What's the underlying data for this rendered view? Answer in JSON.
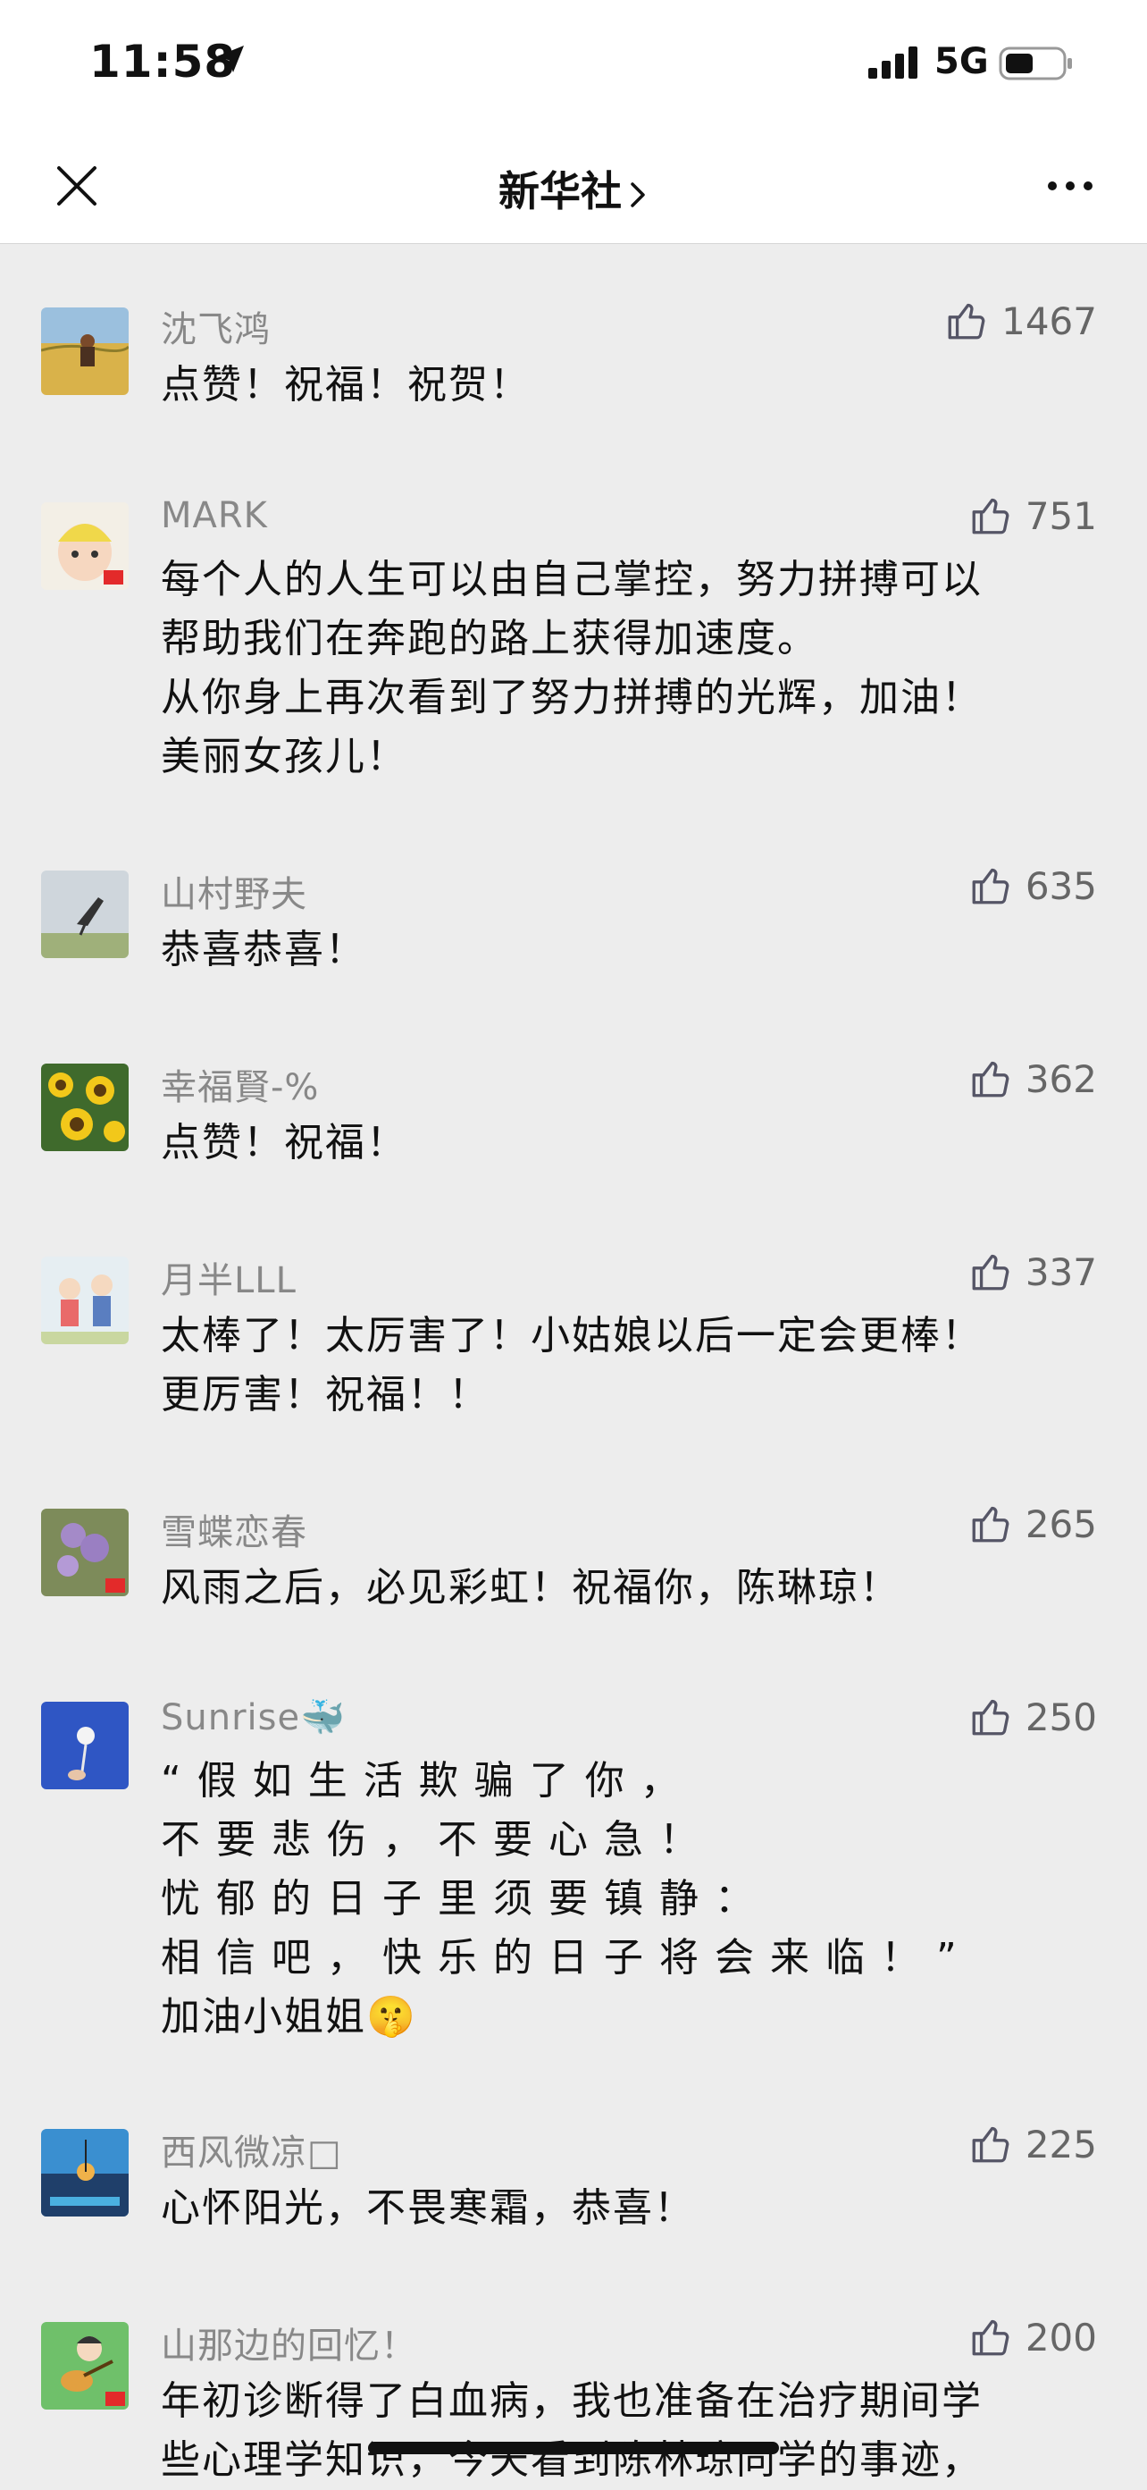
{
  "status_bar": {
    "time": "11:58",
    "network": "5G"
  },
  "nav": {
    "title": "新华社"
  },
  "colors": {
    "background": "#ededed",
    "username": "#888888",
    "text": "#111111"
  },
  "comments": [
    {
      "user": "沈飞鸿",
      "likes": "1467",
      "lines": [
        "点赞！祝福！祝贺！"
      ],
      "avatar": "wheat-field-avatar"
    },
    {
      "user": "MARK",
      "likes": "751",
      "lines": [
        "每个人的人生可以由自己掌控，努力拼搏可以",
        "帮助我们在奔跑的路上获得加速度。",
        "从你身上再次看到了努力拼搏的光辉，加油！",
        "美丽女孩儿！"
      ],
      "avatar": "baby-avatar"
    },
    {
      "user": "山村野夫",
      "likes": "635",
      "lines": [
        "恭喜恭喜！"
      ],
      "avatar": "bird-avatar"
    },
    {
      "user": "幸福賢-%",
      "likes": "362",
      "lines": [
        "点赞！祝福！"
      ],
      "avatar": "sunflower-avatar"
    },
    {
      "user": "月半LLL",
      "likes": "337",
      "lines": [
        "太棒了！太厉害了！小姑娘以后一定会更棒！",
        "更厉害！祝福！！"
      ],
      "avatar": "cartoon-avatar"
    },
    {
      "user": "雪蝶恋春",
      "likes": "265",
      "lines": [
        "风雨之后，必见彩虹！祝福你，陈琳琼！"
      ],
      "avatar": "flower-avatar"
    },
    {
      "user": "Sunrise",
      "user_emoji": "🐳",
      "likes": "250",
      "lines": [
        "“假如生活欺骗了你，",
        "不要悲伤，不要心急！",
        "忧郁的日子里须要镇静：",
        "相信吧，快乐的日子将会来临！”",
        "加油小姐姐"
      ],
      "emoji": "🤫",
      "avatar": "dandelion-avatar"
    },
    {
      "user": "西风微凉□",
      "likes": "225",
      "lines": [
        "心怀阳光，不畏寒霜，恭喜！"
      ],
      "avatar": "sunset-avatar"
    },
    {
      "user": "山那边的回忆！",
      "likes": "200",
      "lines": [
        "年初诊断得了白血病，我也准备在治疗期间学",
        "些心理学知识，今天看到陈林琼同学的事迹，"
      ],
      "avatar": "guitar-avatar"
    }
  ]
}
